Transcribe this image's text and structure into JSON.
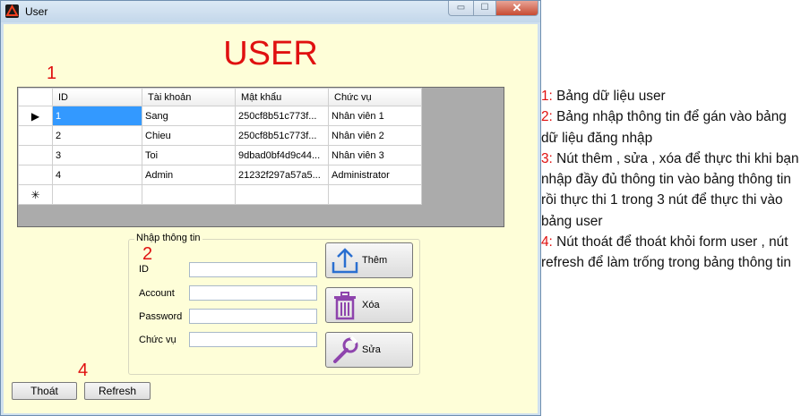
{
  "window": {
    "title": "User",
    "min_glyph": "▭",
    "max_glyph": "☐",
    "close_glyph": "✕"
  },
  "form": {
    "heading": "USER",
    "annotations": [
      "1",
      "2",
      "3",
      "4"
    ],
    "grid": {
      "columns": [
        "ID",
        "Tài khoản",
        "Mật khẩu",
        "Chức vụ"
      ],
      "current_marker": "▶",
      "new_row_marker": "✳",
      "rows": [
        [
          "1",
          "Sang",
          "250cf8b51c773f...",
          "Nhân viên 1"
        ],
        [
          "2",
          "Chieu",
          "250cf8b51c773f...",
          "Nhân viên 2"
        ],
        [
          "3",
          "Toi",
          "9dbad0bf4d9c44...",
          "Nhân viên 3"
        ],
        [
          "4",
          "Admin",
          "21232f297a57a5...",
          "Administrator"
        ]
      ]
    },
    "input_group": {
      "title": "Nhập thông tin",
      "labels": {
        "id": "ID",
        "account": "Account",
        "password": "Password",
        "role": "Chức vụ"
      },
      "values": {
        "id": "",
        "account": "",
        "password": "",
        "role": ""
      }
    },
    "buttons": {
      "add": "Thêm",
      "delete": "Xóa",
      "edit": "Sửa",
      "exit": "Thoát",
      "refresh": "Refresh"
    }
  },
  "notes": [
    {
      "num": "1:",
      "text": " Bảng dữ liệu user"
    },
    {
      "num": "2:",
      "text": " Bảng nhập thông tin để gán vào bảng dữ liệu đăng nhập"
    },
    {
      "num": "3:",
      "text": " Nút thêm , sửa , xóa để thực thi khi bạn nhập đầy đủ thông tin vào bảng thông tin rồi thực thi 1 trong 3 nút để thực thi vào bảng user"
    },
    {
      "num": "4:",
      "text": " Nút thoát để thoát khỏi form user , nút refresh để làm trống trong bảng thông tin"
    }
  ],
  "colors": {
    "accent_red": "#e01010",
    "form_bg": "#fefed8",
    "selection": "#3399ff"
  }
}
